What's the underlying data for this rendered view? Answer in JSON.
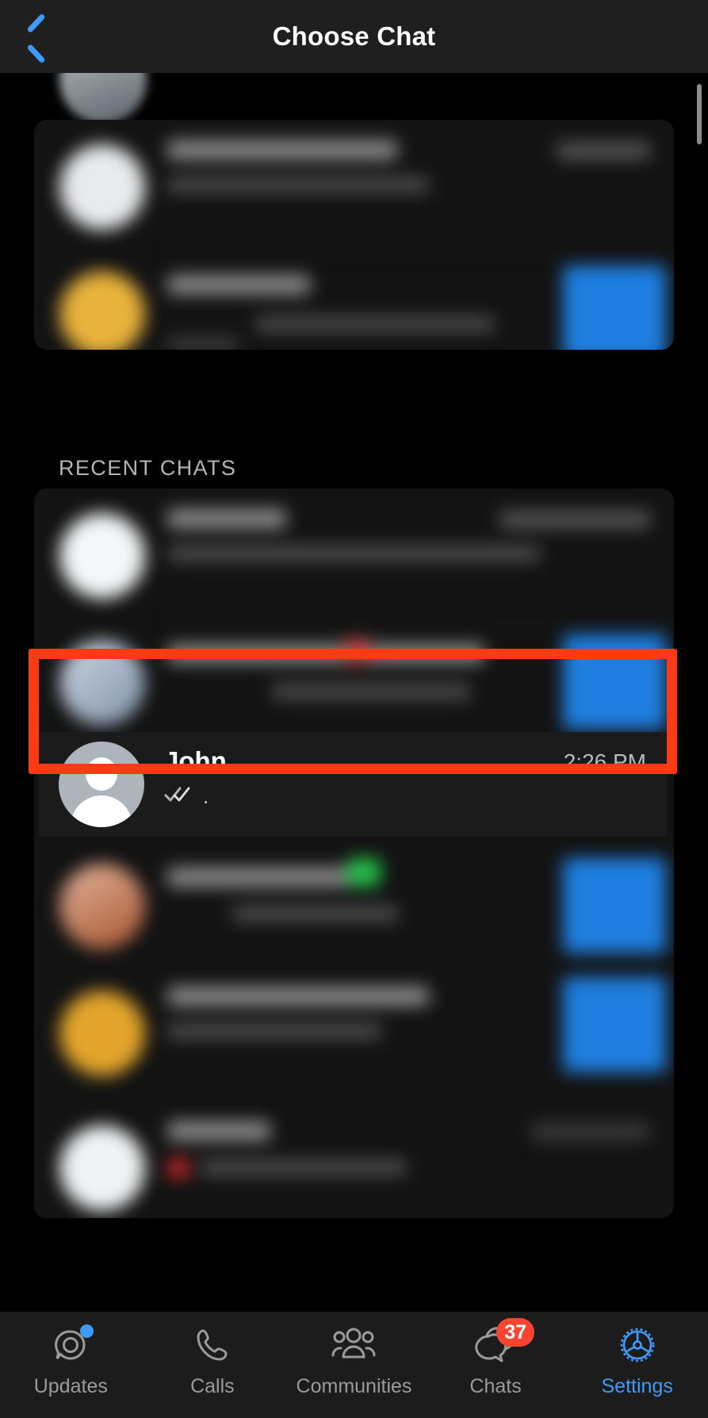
{
  "header": {
    "title": "Choose Chat",
    "back_icon": "chevron-left-icon",
    "accent_color": "#3f9bfb"
  },
  "sections": {
    "recent_chats_label": "RECENT CHATS"
  },
  "highlighted_chat": {
    "name": "John",
    "snippet": ".",
    "time": "2:26 PM",
    "read_status_icon": "double-check-icon",
    "avatar_icon": "default-person-avatar-icon",
    "highlight_color": "#fb3b16"
  },
  "tabbar": {
    "items": [
      {
        "label": "Updates",
        "icon": "updates-status-ring-icon",
        "active": false,
        "dot": true,
        "badge": ""
      },
      {
        "label": "Calls",
        "icon": "phone-icon",
        "active": false,
        "dot": false,
        "badge": ""
      },
      {
        "label": "Communities",
        "icon": "communities-people-icon",
        "active": false,
        "dot": false,
        "badge": ""
      },
      {
        "label": "Chats",
        "icon": "chat-bubbles-icon",
        "active": false,
        "dot": false,
        "badge": "37"
      },
      {
        "label": "Settings",
        "icon": "gear-icon",
        "active": true,
        "dot": false,
        "badge": ""
      }
    ],
    "badge_color": "#f9452f",
    "active_color": "#3f9bfb",
    "inactive_color": "#9b9b9b"
  },
  "obscured": {
    "note": "blurred-chat-rows"
  }
}
